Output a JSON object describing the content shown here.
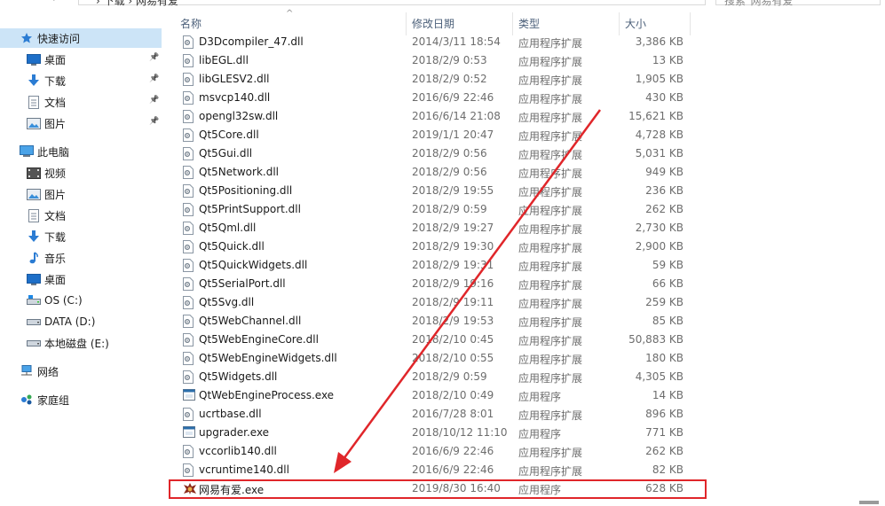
{
  "toolbar": {
    "breadcrumb": "› 下载 › 网易有爱",
    "search_placeholder": "搜索\"网易有爱\""
  },
  "nav": {
    "items": [
      {
        "label": "快速访问",
        "icon": "star-icon",
        "selected": true,
        "indent": 1,
        "pinned": false
      },
      {
        "label": "桌面",
        "icon": "desktop-icon",
        "selected": false,
        "indent": 2,
        "pinned": true
      },
      {
        "label": "下载",
        "icon": "download-icon",
        "selected": false,
        "indent": 2,
        "pinned": true
      },
      {
        "label": "文档",
        "icon": "document-icon",
        "selected": false,
        "indent": 2,
        "pinned": true
      },
      {
        "label": "图片",
        "icon": "picture-icon",
        "selected": false,
        "indent": 2,
        "pinned": true
      },
      {
        "label": "此电脑",
        "icon": "computer-icon",
        "selected": false,
        "indent": 1,
        "pinned": false
      },
      {
        "label": "视频",
        "icon": "video-icon",
        "selected": false,
        "indent": 2,
        "pinned": false
      },
      {
        "label": "图片",
        "icon": "picture-icon",
        "selected": false,
        "indent": 2,
        "pinned": false
      },
      {
        "label": "文档",
        "icon": "document-icon",
        "selected": false,
        "indent": 2,
        "pinned": false
      },
      {
        "label": "下载",
        "icon": "download-icon",
        "selected": false,
        "indent": 2,
        "pinned": false
      },
      {
        "label": "音乐",
        "icon": "music-icon",
        "selected": false,
        "indent": 2,
        "pinned": false
      },
      {
        "label": "桌面",
        "icon": "desktop-icon",
        "selected": false,
        "indent": 2,
        "pinned": false
      },
      {
        "label": "OS (C:)",
        "icon": "os-drive-icon",
        "selected": false,
        "indent": 2,
        "pinned": false
      },
      {
        "label": "DATA (D:)",
        "icon": "drive-icon",
        "selected": false,
        "indent": 2,
        "pinned": false
      },
      {
        "label": "本地磁盘 (E:)",
        "icon": "drive-icon",
        "selected": false,
        "indent": 2,
        "pinned": false
      },
      {
        "label": "网络",
        "icon": "network-icon",
        "selected": false,
        "indent": 1,
        "pinned": false
      },
      {
        "label": "家庭组",
        "icon": "homegroup-icon",
        "selected": false,
        "indent": 1,
        "pinned": false
      }
    ]
  },
  "columns": {
    "name": "名称",
    "date": "修改日期",
    "type": "类型",
    "size": "大小"
  },
  "files": [
    {
      "name": "D3Dcompiler_47.dll",
      "date": "2014/3/11 18:54",
      "type": "应用程序扩展",
      "size": "3,386 KB",
      "icon": "dll-file-icon"
    },
    {
      "name": "libEGL.dll",
      "date": "2018/2/9 0:53",
      "type": "应用程序扩展",
      "size": "13 KB",
      "icon": "dll-file-icon"
    },
    {
      "name": "libGLESV2.dll",
      "date": "2018/2/9 0:52",
      "type": "应用程序扩展",
      "size": "1,905 KB",
      "icon": "dll-file-icon"
    },
    {
      "name": "msvcp140.dll",
      "date": "2016/6/9 22:46",
      "type": "应用程序扩展",
      "size": "430 KB",
      "icon": "dll-file-icon"
    },
    {
      "name": "opengl32sw.dll",
      "date": "2016/6/14 21:08",
      "type": "应用程序扩展",
      "size": "15,621 KB",
      "icon": "dll-file-icon"
    },
    {
      "name": "Qt5Core.dll",
      "date": "2019/1/1 20:47",
      "type": "应用程序扩展",
      "size": "4,728 KB",
      "icon": "dll-file-icon"
    },
    {
      "name": "Qt5Gui.dll",
      "date": "2018/2/9 0:56",
      "type": "应用程序扩展",
      "size": "5,031 KB",
      "icon": "dll-file-icon"
    },
    {
      "name": "Qt5Network.dll",
      "date": "2018/2/9 0:56",
      "type": "应用程序扩展",
      "size": "949 KB",
      "icon": "dll-file-icon"
    },
    {
      "name": "Qt5Positioning.dll",
      "date": "2018/2/9 19:55",
      "type": "应用程序扩展",
      "size": "236 KB",
      "icon": "dll-file-icon"
    },
    {
      "name": "Qt5PrintSupport.dll",
      "date": "2018/2/9 0:59",
      "type": "应用程序扩展",
      "size": "262 KB",
      "icon": "dll-file-icon"
    },
    {
      "name": "Qt5Qml.dll",
      "date": "2018/2/9 19:27",
      "type": "应用程序扩展",
      "size": "2,730 KB",
      "icon": "dll-file-icon"
    },
    {
      "name": "Qt5Quick.dll",
      "date": "2018/2/9 19:30",
      "type": "应用程序扩展",
      "size": "2,900 KB",
      "icon": "dll-file-icon"
    },
    {
      "name": "Qt5QuickWidgets.dll",
      "date": "2018/2/9 19:31",
      "type": "应用程序扩展",
      "size": "59 KB",
      "icon": "dll-file-icon"
    },
    {
      "name": "Qt5SerialPort.dll",
      "date": "2018/2/9 19:16",
      "type": "应用程序扩展",
      "size": "66 KB",
      "icon": "dll-file-icon"
    },
    {
      "name": "Qt5Svg.dll",
      "date": "2018/2/9 19:11",
      "type": "应用程序扩展",
      "size": "259 KB",
      "icon": "dll-file-icon"
    },
    {
      "name": "Qt5WebChannel.dll",
      "date": "2018/2/9 19:53",
      "type": "应用程序扩展",
      "size": "85 KB",
      "icon": "dll-file-icon"
    },
    {
      "name": "Qt5WebEngineCore.dll",
      "date": "2018/2/10 0:45",
      "type": "应用程序扩展",
      "size": "50,883 KB",
      "icon": "dll-file-icon"
    },
    {
      "name": "Qt5WebEngineWidgets.dll",
      "date": "2018/2/10 0:55",
      "type": "应用程序扩展",
      "size": "180 KB",
      "icon": "dll-file-icon"
    },
    {
      "name": "Qt5Widgets.dll",
      "date": "2018/2/9 0:59",
      "type": "应用程序扩展",
      "size": "4,305 KB",
      "icon": "dll-file-icon"
    },
    {
      "name": "QtWebEngineProcess.exe",
      "date": "2018/2/10 0:49",
      "type": "应用程序",
      "size": "14 KB",
      "icon": "exe-file-icon"
    },
    {
      "name": "ucrtbase.dll",
      "date": "2016/7/28 8:01",
      "type": "应用程序扩展",
      "size": "896 KB",
      "icon": "dll-file-icon"
    },
    {
      "name": "upgrader.exe",
      "date": "2018/10/12 11:10",
      "type": "应用程序",
      "size": "771 KB",
      "icon": "exe-file-icon"
    },
    {
      "name": "vccorlib140.dll",
      "date": "2016/6/9 22:46",
      "type": "应用程序扩展",
      "size": "262 KB",
      "icon": "dll-file-icon"
    },
    {
      "name": "vcruntime140.dll",
      "date": "2016/6/9 22:46",
      "type": "应用程序扩展",
      "size": "82 KB",
      "icon": "dll-file-icon"
    },
    {
      "name": "网易有爱.exe",
      "date": "2019/8/30 16:40",
      "type": "应用程序",
      "size": "628 KB",
      "icon": "app-logo-icon",
      "highlighted": true
    }
  ],
  "colors": {
    "nav_selected": "#cce4f7",
    "annotation_red": "#e0262a",
    "header_text": "#4c607a"
  }
}
